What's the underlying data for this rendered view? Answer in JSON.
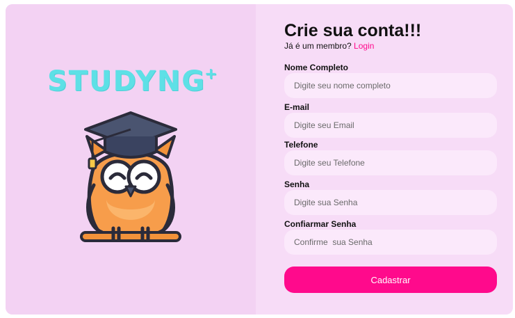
{
  "brand": {
    "name": "STUDYNG",
    "plus": "+"
  },
  "form": {
    "title": "Crie sua conta!!!",
    "member_prompt": "Já é um membro?",
    "login_label": "Login",
    "fields": [
      {
        "label": "Nome Completo",
        "placeholder": "Digite seu nome completo",
        "value": ""
      },
      {
        "label": "E-mail",
        "placeholder": "Digite seu Email",
        "value": ""
      },
      {
        "label": "Telefone",
        "placeholder": "Digite seu Telefone",
        "value": ""
      },
      {
        "label": "Senha",
        "placeholder": "Digite sua Senha",
        "value": ""
      },
      {
        "label": "Confiarmar Senha",
        "placeholder": "Confirme  sua Senha",
        "value": ""
      }
    ],
    "submit_label": "Cadastrar"
  },
  "colors": {
    "accent": "#ff0a8c",
    "brand_cyan": "#5ee0e6",
    "card_background": "#f7dcf7",
    "input_background": "#fbe9fb"
  },
  "illustration": {
    "icon": "owl-graduate-icon"
  }
}
